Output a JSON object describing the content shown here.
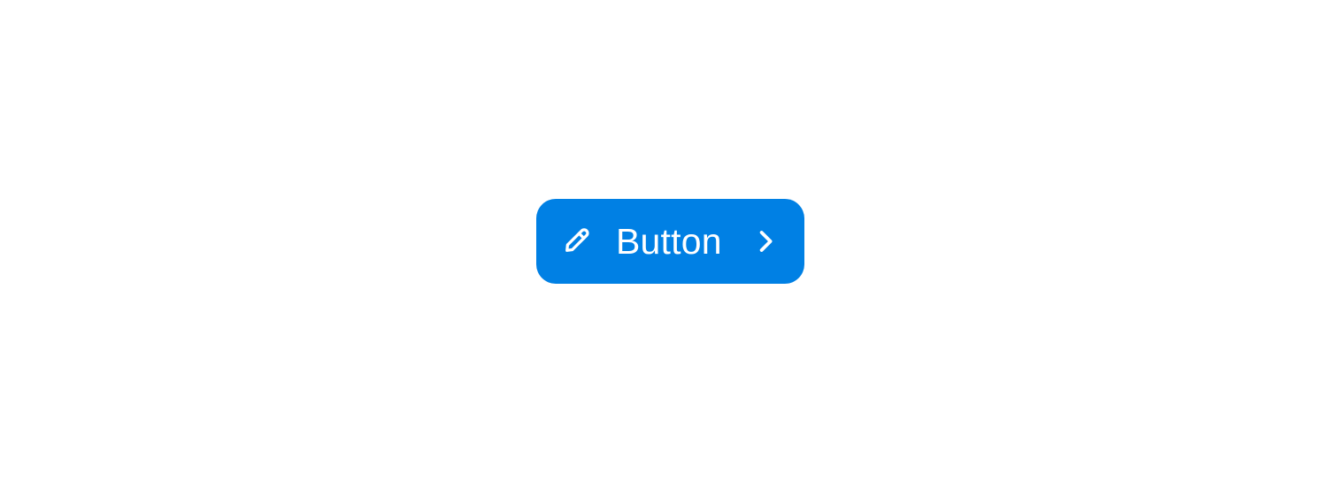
{
  "button": {
    "label": "Button",
    "background_color": "#0080e4",
    "text_color": "#ffffff",
    "leading_icon": "pencil-icon",
    "trailing_icon": "chevron-right-icon"
  }
}
